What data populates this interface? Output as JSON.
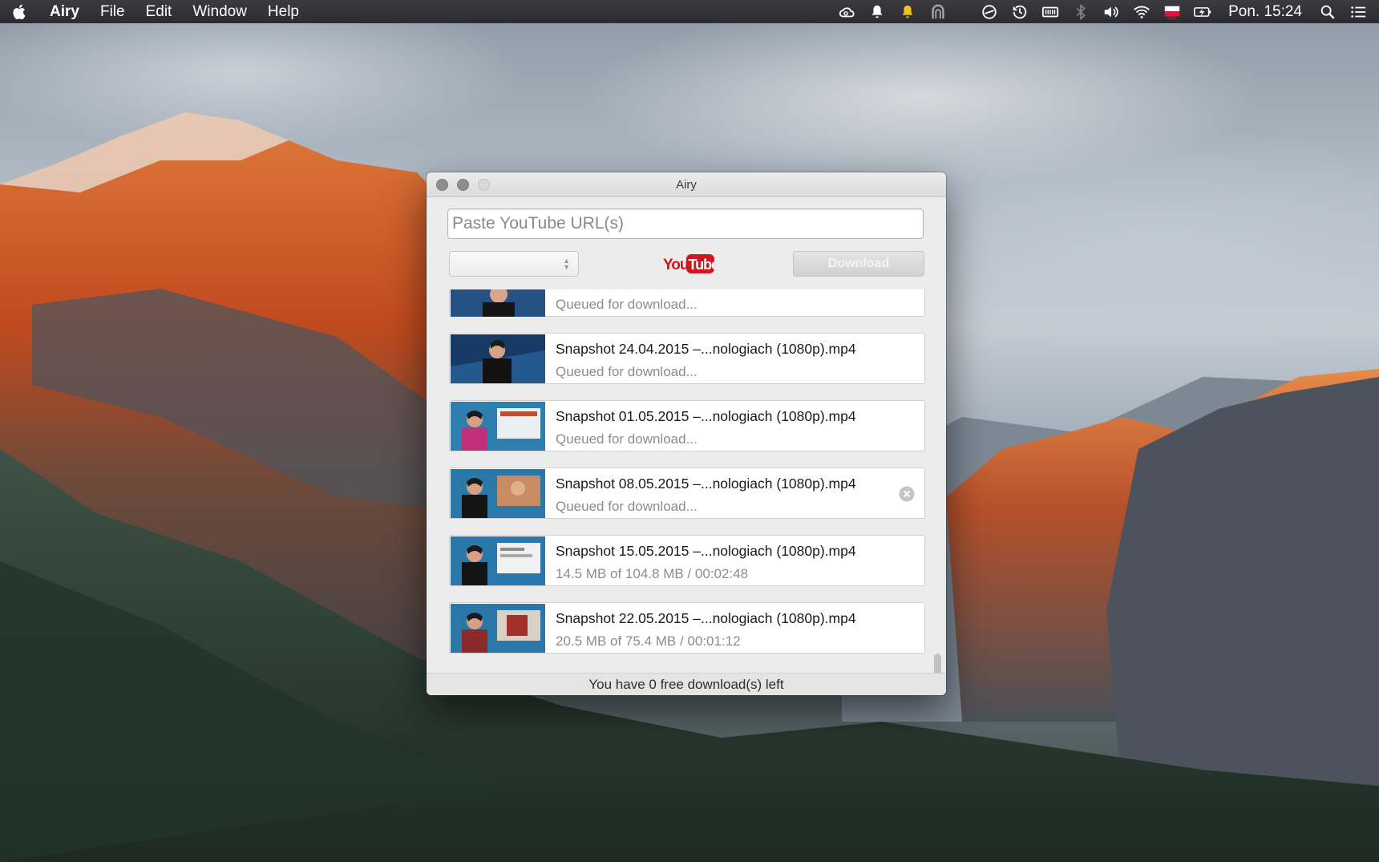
{
  "menubar": {
    "app_name": "Airy",
    "menus": [
      "File",
      "Edit",
      "Window",
      "Help"
    ],
    "tray_icons": [
      "creative-cloud-icon",
      "bell-icon",
      "notification-icon",
      "arch-icon",
      "sync-icon",
      "time-machine-icon",
      "memory-icon",
      "bluetooth-icon",
      "volume-icon",
      "wifi-icon",
      "flag-pro-icon",
      "battery-icon"
    ],
    "clock": "Pon. 15:24"
  },
  "window": {
    "title": "Airy",
    "url_placeholder": "Paste YouTube URL(s)",
    "format_value": "",
    "download_label": "Download",
    "logo_text_you": "You",
    "logo_text_tube": "Tube",
    "footer_text": "You have 0 free download(s) left"
  },
  "downloads": [
    {
      "name": "",
      "status": "Queued for download..."
    },
    {
      "name": "Snapshot 24.04.2015 –...nologiach (1080p).mp4",
      "status": "Queued for download..."
    },
    {
      "name": "Snapshot 01.05.2015 –...nologiach (1080p).mp4",
      "status": "Queued for download..."
    },
    {
      "name": "Snapshot 08.05.2015 –...nologiach (1080p).mp4",
      "status": "Queued for download..."
    },
    {
      "name": "Snapshot 15.05.2015 –...nologiach (1080p).mp4",
      "status": "14.5 MB of 104.8 MB / 00:02:48"
    },
    {
      "name": "Snapshot 22.05.2015 –...nologiach (1080p).mp4",
      "status": "20.5 MB of 75.4 MB / 00:01:12"
    }
  ],
  "colors": {
    "youtube_red": "#cc181e",
    "menubar": "#2f2f33"
  }
}
